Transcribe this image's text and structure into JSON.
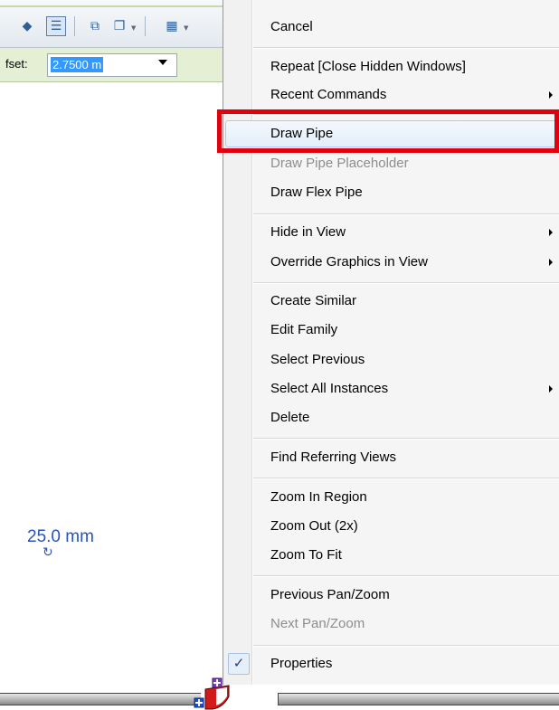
{
  "toolbar": {
    "icons": [
      "pin-icon",
      "properties-list-icon",
      "remove-icon",
      "copy-icon",
      "filter-icon"
    ]
  },
  "options_bar": {
    "offset_label": "fset:",
    "offset_value": "2.7500 m"
  },
  "canvas": {
    "dimension_text": "25.0 mm"
  },
  "context_menu": {
    "items": [
      {
        "label": "Cancel"
      },
      {
        "label": "Repeat [Close Hidden Windows]"
      },
      {
        "label": "Recent Commands",
        "submenu": true
      },
      {
        "label": "Draw Pipe",
        "highlighted": true
      },
      {
        "label": "Draw Pipe Placeholder",
        "disabled": true
      },
      {
        "label": "Draw Flex Pipe"
      },
      {
        "label": "Hide in View",
        "submenu": true
      },
      {
        "label": "Override Graphics in View",
        "submenu": true
      },
      {
        "label": "Create Similar"
      },
      {
        "label": "Edit Family"
      },
      {
        "label": "Select Previous"
      },
      {
        "label": "Select All Instances",
        "submenu": true
      },
      {
        "label": "Delete"
      },
      {
        "label": "Find Referring Views"
      },
      {
        "label": "Zoom In Region"
      },
      {
        "label": "Zoom Out (2x)"
      },
      {
        "label": "Zoom To Fit"
      },
      {
        "label": "Previous Pan/Zoom"
      },
      {
        "label": "Next Pan/Zoom",
        "disabled": true
      },
      {
        "label": "Properties",
        "checked": true
      }
    ]
  },
  "colors": {
    "highlight_outline": "#e0000e",
    "dimension_text": "#2a52be",
    "selection": "#3399ff"
  }
}
